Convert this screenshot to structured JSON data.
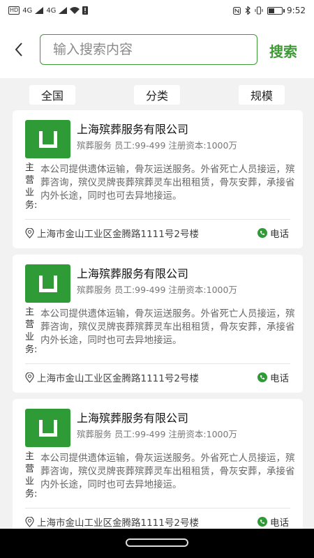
{
  "status_bar": {
    "left_tags": [
      "HD",
      "4G",
      "4G"
    ],
    "time": "9:52"
  },
  "search": {
    "placeholder": "输入搜索内容",
    "button_label": "搜索"
  },
  "filters": [
    "全国",
    "分类",
    "规模"
  ],
  "business_label": "主营业务:",
  "cards": [
    {
      "name": "上海殡葬服务有限公司",
      "meta": "殡葬服务 员工:99-499 注册资本:1000万",
      "business": "本公司提供遗体运输，骨灰运送服务。外省死亡人员接运，殡葬咨询，殡仪灵牌丧葬殡葬灵车出租租赁，骨灰安葬，承接省内外长途，同时也可去异地接运。",
      "address": "上海市金山工业区金腾路1111号2号楼",
      "phone_label": "电话"
    },
    {
      "name": "上海殡葬服务有限公司",
      "meta": "殡葬服务 员工:99-499 注册资本:1000万",
      "business": "本公司提供遗体运输，骨灰运送服务。外省死亡人员接运，殡葬咨询，殡仪灵牌丧葬殡葬灵车出租租赁，骨灰安葬，承接省内外长途，同时也可去异地接运。",
      "address": "上海市金山工业区金腾路1111号2号楼",
      "phone_label": "电话"
    },
    {
      "name": "上海殡葬服务有限公司",
      "meta": "殡葬服务 员工:99-499 注册资本:1000万",
      "business": "本公司提供遗体运输，骨灰运送服务。外省死亡人员接运，殡葬咨询，殡仪灵牌丧葬殡葬灵车出租租赁，骨灰安葬，承接省内外长途，同时也可去异地接运。",
      "address": "上海市金山工业区金腾路1111号2号楼",
      "phone_label": "电话"
    }
  ],
  "colors": {
    "accent": "#3e9a34",
    "logo_bg": "#2f9b37",
    "page_bg": "#f2f2f2"
  },
  "icons": [
    "back-arrow-icon",
    "location-pin-icon",
    "phone-icon",
    "wifi-icon",
    "bluetooth-icon",
    "nfc-icon",
    "battery-icon"
  ]
}
